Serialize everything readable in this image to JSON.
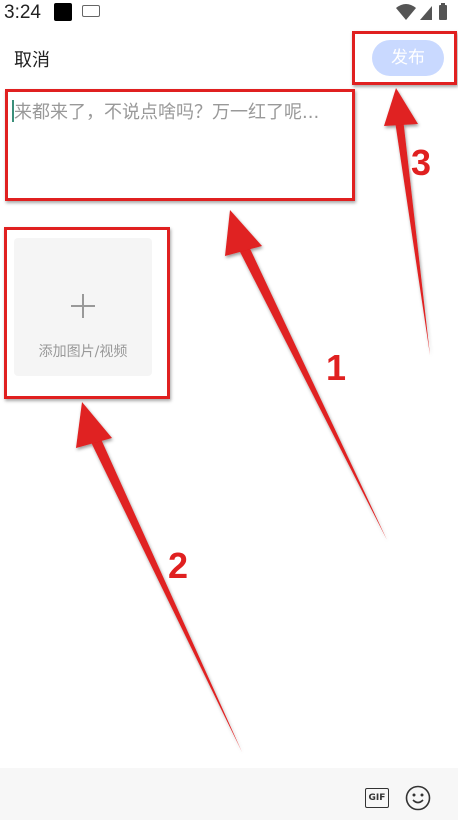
{
  "status_bar": {
    "time": "3:24"
  },
  "header": {
    "cancel_label": "取消",
    "publish_label": "发布"
  },
  "editor": {
    "placeholder": "来都来了，不说点啥吗？万一红了呢..."
  },
  "media": {
    "add_label": "添加图片/视频"
  },
  "toolbar": {
    "gif_label": "GIF"
  },
  "annotations": {
    "labels": [
      "1",
      "2",
      "3"
    ]
  },
  "colors": {
    "publish_bg": "#c9d9ff",
    "annotation": "#e02020",
    "caret": "#3a8f7a"
  }
}
